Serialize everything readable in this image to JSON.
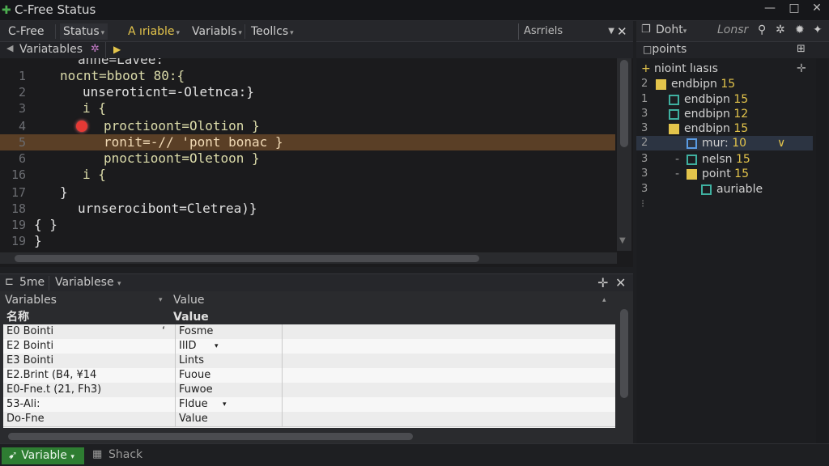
{
  "window": {
    "title": "C-Free Status",
    "controls": [
      "—",
      "□",
      "✕"
    ]
  },
  "toolbar": {
    "items": [
      {
        "label": "C-Free"
      },
      {
        "label": "Status",
        "arrow": "▾"
      },
      {
        "label": "A ıriable",
        "arrow": "▾"
      },
      {
        "label": "Variabls",
        "arrow": "▾"
      },
      {
        "label": "Teollcs",
        "arrow": "▾"
      }
    ],
    "combo_value": "Asrriels",
    "close": "✕"
  },
  "editor_tabs": {
    "label": "Variatables",
    "marker": "✲",
    "run": "▶"
  },
  "editor": {
    "top_partial": "ânne=Lavee:",
    "lines": [
      {
        "num": "1",
        "code": "nocnt=bboot 80:{"
      },
      {
        "num": "2",
        "code": "unseroticnt=-Oletnca:}"
      },
      {
        "num": "3",
        "code": "i {"
      },
      {
        "num": "4",
        "code": "proctioont=Olotion }"
      },
      {
        "num": "5",
        "code": "ronit=-// 'pont bonac }"
      },
      {
        "num": "6",
        "code": "pnoctioont=Oletoon }"
      },
      {
        "num": "16",
        "code": "i {"
      },
      {
        "num": "17",
        "code": "}"
      },
      {
        "num": "18",
        "code": "urnserocibont=Cletrea)}"
      },
      {
        "num": "19",
        "code": "{ }"
      },
      {
        "num": "19",
        "code": "}"
      }
    ]
  },
  "right_panel": {
    "tabs": [
      {
        "label": "Doht",
        "arrow": "▾"
      },
      {
        "label": "Lonsr"
      }
    ],
    "sub_label": "points",
    "tree": [
      {
        "num": "",
        "label": "nioint lıasıs",
        "prefix": "+"
      },
      {
        "num": "2",
        "label": "endbipn",
        "value": "15"
      },
      {
        "num": "1",
        "label": "endbipn",
        "value": "15"
      },
      {
        "num": "3",
        "label": "endbipn",
        "value": "12"
      },
      {
        "num": "3",
        "label": "endbipn",
        "value": "15"
      },
      {
        "num": "2",
        "label": "mur:",
        "value": "10",
        "selected": true,
        "suffix": "∨"
      },
      {
        "num": "3",
        "label": "nelsn",
        "value": "15",
        "prefix": "-"
      },
      {
        "num": "3",
        "label": "point",
        "value": "15",
        "prefix": "-"
      },
      {
        "num": "3",
        "label": "auriable"
      }
    ]
  },
  "bottom_panel": {
    "tabs": [
      {
        "label": "5me"
      },
      {
        "label": "Variablese",
        "arrow": "▾"
      }
    ],
    "header": {
      "col1": "Variables",
      "col2": "Value"
    },
    "subheader": {
      "col1": "名称",
      "col2": "Value"
    },
    "rows": [
      {
        "name": "E0 Bointi",
        "flag": "ʻ",
        "value": "Fosme"
      },
      {
        "name": "E2 Bointi",
        "value": "IIID",
        "arrow": "▾"
      },
      {
        "name": "E3 Bointi",
        "value": "Lints"
      },
      {
        "name": "E2.Brint (B4, ¥14",
        "value": "Fuoue"
      },
      {
        "name": "E0-Fne.t (21, Fh3)",
        "value": "Fuwoe"
      },
      {
        "name": "53-Ali:",
        "value": "Fldue",
        "arrow": "▾"
      },
      {
        "name": "Do-Fne",
        "value": "Value"
      }
    ]
  },
  "statusbar": {
    "primary": "Variable",
    "primary_arrow": "▾",
    "secondary": "Shack"
  },
  "colors": {
    "breakpoint": "#e53935",
    "highlight": "#5a3f26",
    "accent_yellow": "#e3c44b",
    "status_green": "#2e7d32"
  }
}
